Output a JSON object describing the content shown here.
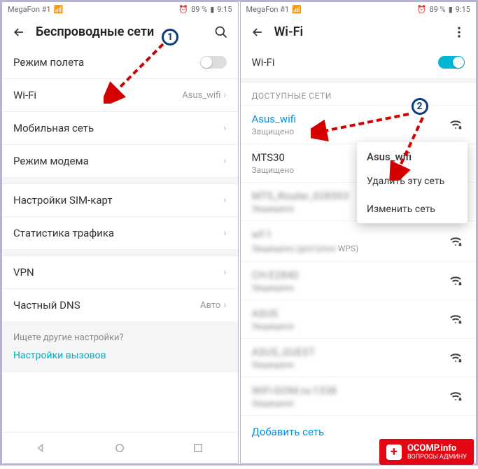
{
  "status": {
    "carrier": "MegaFon #1",
    "battery_pct": "89 %",
    "time": "9:15",
    "alarm_icon": "⏰"
  },
  "left": {
    "title": "Беспроводные сети",
    "items": {
      "airplane": "Режим полета",
      "wifi": "Wi-Fi",
      "wifi_val": "Asus_wifi",
      "mobile": "Мобильная сеть",
      "modem": "Режим модема",
      "sim": "Настройки SIM-карт",
      "traffic": "Статистика трафика",
      "vpn": "VPN",
      "dns": "Частный DNS",
      "dns_val": "Авто"
    },
    "hint_title": "Ищете другие настройки?",
    "hint_link": "Настройки вызовов"
  },
  "right": {
    "title": "Wi-Fi",
    "toggle_label": "Wi-Fi",
    "section": "ДОСТУПНЫЕ СЕТИ",
    "networks": [
      {
        "name": "Asus_wifi",
        "sub": "Защищено",
        "active": true
      },
      {
        "name": "MTS30",
        "sub": "Защищено"
      },
      {
        "name": "MTS_Router_028593",
        "sub": "Защищено",
        "blur": true
      },
      {
        "name": "wf-1",
        "sub": "Защищено (доступно WPS)",
        "blur": true,
        "wps": true
      },
      {
        "name": "CH-E2840",
        "sub": "Защищено",
        "blur": true
      },
      {
        "name": "ASUS",
        "sub": "Защищено",
        "blur": true
      },
      {
        "name": "ASUS_GUEST",
        "sub": "Защищено",
        "blur": true
      },
      {
        "name": "WiFi-DOM.ru-1338",
        "sub": "Защищено",
        "blur": true
      }
    ],
    "add": "Добавить сеть",
    "ctx": {
      "title": "Asus_wifi",
      "delete": "Удалить эту сеть",
      "modify": "Изменить сеть"
    }
  },
  "watermark": {
    "main": "OCOMP.info",
    "sub": "ВОПРОСЫ АДМИНУ"
  }
}
